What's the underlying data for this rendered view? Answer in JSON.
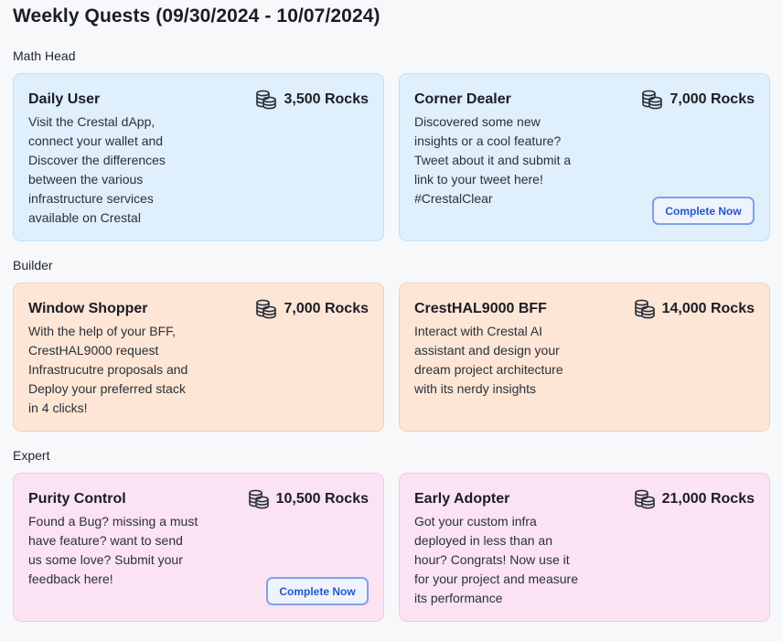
{
  "page_title": "Weekly Quests (09/30/2024 - 10/07/2024)",
  "sections": [
    {
      "label": "Math Head",
      "quests": [
        {
          "title": "Daily User",
          "reward": "3,500 Rocks",
          "description": "Visit the Crestal dApp,\nconnect your wallet and\nDiscover the differences\nbetween the various\ninfrastructure services\navailable on Crestal",
          "button": ""
        },
        {
          "title": "Corner Dealer",
          "reward": "7,000 Rocks",
          "description": "Discovered some new\ninsights or a cool feature?\nTweet about it and submit a\nlink to your tweet here!\n#CrestalClear",
          "button": "Complete Now"
        }
      ]
    },
    {
      "label": "Builder",
      "quests": [
        {
          "title": "Window Shopper",
          "reward": "7,000 Rocks",
          "description": "With the help of your BFF,\nCrestHAL9000 request\nInfrastrucutre proposals and\nDeploy your preferred stack\nin 4 clicks!",
          "button": ""
        },
        {
          "title": "CrestHAL9000 BFF",
          "reward": "14,000 Rocks",
          "description": "Interact with Crestal AI\nassistant and design your\ndream project architecture\nwith its nerdy insights",
          "button": ""
        }
      ]
    },
    {
      "label": "Expert",
      "quests": [
        {
          "title": "Purity Control",
          "reward": "10,500 Rocks",
          "description": "Found a Bug? missing a must\nhave feature? want to send\nus some love? Submit your\nfeedback here!",
          "button": "Complete Now"
        },
        {
          "title": "Early Adopter",
          "reward": "21,000 Rocks",
          "description": "Got your custom infra\ndeployed in less than an\nhour? Congrats! Now use it\nfor your project and measure\nits performance",
          "button": ""
        }
      ]
    }
  ],
  "icons": {
    "reward": "coins-stack-icon"
  },
  "colors": {
    "blue_card": "#dff0fc",
    "orange_card": "#fde6d5",
    "pink_card": "#fbe3f3",
    "button_text": "#2458c8",
    "button_border": "#7ea2e6"
  }
}
